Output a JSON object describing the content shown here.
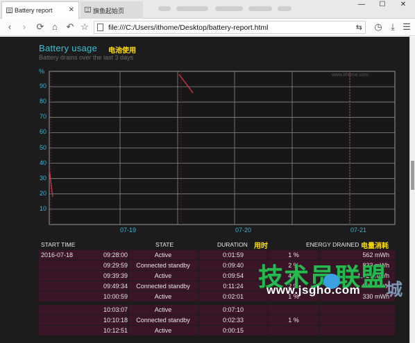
{
  "browser": {
    "active_tab": "Battery report",
    "inactive_tab": "旗鱼起始页",
    "url": "file:///C:/Users/ithome/Desktop/battery-report.html"
  },
  "section": {
    "title": "Battery usage",
    "title_cn": "电池使用",
    "subtitle": "Battery drains over the last 3 days"
  },
  "chart_data": {
    "type": "line",
    "ylabel": "%",
    "yticks": [
      "90",
      "80",
      "70",
      "60",
      "50",
      "40",
      "30",
      "20",
      "10"
    ],
    "ylim": [
      0,
      100
    ],
    "xticks": [
      "07-19",
      "07-20",
      "07-21"
    ],
    "grid": true,
    "watermark": "www.ithome.com",
    "series": [
      {
        "segment": 1,
        "x": [
          "07-18 ~21:00",
          "07-18 ~21:30"
        ],
        "y": [
          36,
          18
        ]
      },
      {
        "segment": 2,
        "x": [
          "07-19 ~18:40",
          "07-19 ~19:20"
        ],
        "y": [
          98,
          86
        ]
      }
    ]
  },
  "table": {
    "headers": {
      "start_time": "START TIME",
      "state": "STATE",
      "duration": "DURATION",
      "duration_cn": "用时",
      "energy": "ENERGY DRAINED",
      "energy_cn": "电量消耗"
    },
    "rows": [
      {
        "date": "2016-07-18",
        "time": "09:28:00",
        "state": "Active",
        "duration": "0:01:59",
        "pct": "1 %",
        "energy": "562 mWh"
      },
      {
        "date": "",
        "time": "09:29:59",
        "state": "Connected standby",
        "duration": "0:09:40",
        "pct": "2 %",
        "energy": "833 mWh"
      },
      {
        "date": "",
        "time": "09:39:39",
        "state": "Active",
        "duration": "0:09:54",
        "pct": "4 %",
        "energy": "1,627 mWh"
      },
      {
        "date": "",
        "time": "09:49:34",
        "state": "Connected standby",
        "duration": "0:11:24",
        "pct": "2 %",
        "energy": "900 mWh"
      },
      {
        "date": "",
        "time": "10:00:59",
        "state": "Active",
        "duration": "0:02:01",
        "pct": "1 %",
        "energy": "330 mWh"
      },
      {
        "date": "",
        "time": "10:03:07",
        "state": "Active",
        "duration": "0:07:10",
        "pct": "",
        "energy": ""
      },
      {
        "date": "",
        "time": "10:10:18",
        "state": "Connected standby",
        "duration": "0:02:33",
        "pct": "1 %",
        "energy": ""
      },
      {
        "date": "",
        "time": "10:12:51",
        "state": "Active",
        "duration": "0:00:15",
        "pct": "",
        "energy": ""
      }
    ]
  },
  "watermark": {
    "big": "技术员联盟",
    "url": "www.jsgho.com",
    "cheng": "城"
  },
  "colors": {
    "accent": "#3cc0d6",
    "annotation": "#ffe000",
    "row_bg": "#3a1427",
    "line": "#d0303f"
  }
}
